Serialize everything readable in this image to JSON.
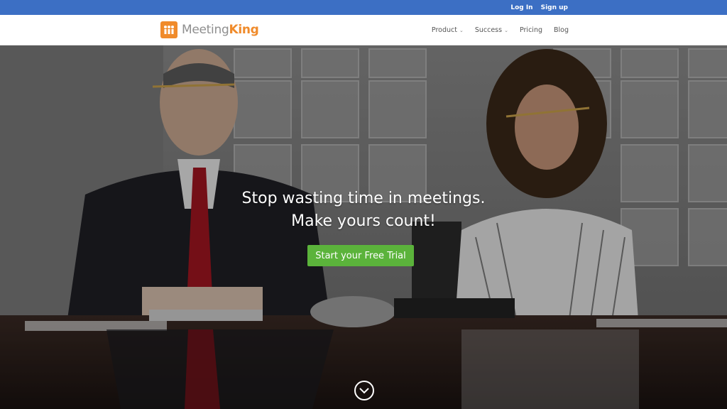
{
  "topbar": {
    "login": "Log In",
    "signup": "Sign up"
  },
  "logo": {
    "part1": "Meeting",
    "part2": "King"
  },
  "menu": [
    {
      "label": "Product",
      "has_dropdown": true
    },
    {
      "label": "Success",
      "has_dropdown": true
    },
    {
      "label": "Pricing",
      "has_dropdown": false
    },
    {
      "label": "Blog",
      "has_dropdown": false
    }
  ],
  "hero": {
    "headline": "Stop wasting time in meetings. Make yours count!",
    "cta": "Start your Free Trial"
  },
  "colors": {
    "topbar": "#3c6fc4",
    "brand": "#f08b2b",
    "cta": "#5bb33b"
  },
  "icons": {
    "logo": "meetingking-logo-icon",
    "scroll": "chevron-down-circle-icon"
  }
}
